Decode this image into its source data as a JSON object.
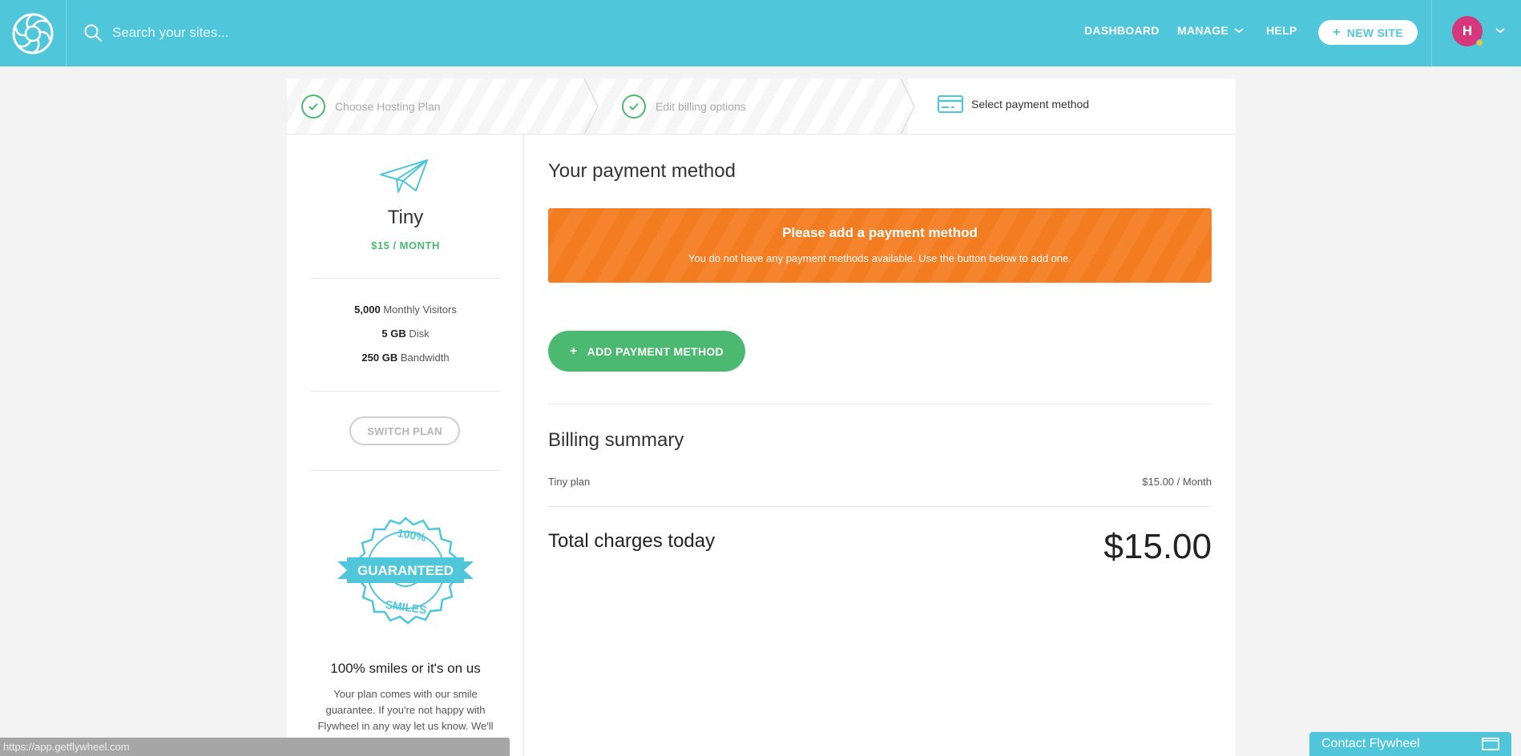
{
  "header": {
    "search_placeholder": "Search your sites...",
    "nav": {
      "dashboard": "DASHBOARD",
      "manage": "MANAGE",
      "help": "HELP"
    },
    "new_site_label": "NEW SITE",
    "avatar_initial": "H"
  },
  "steps": [
    {
      "label": "Choose Hosting Plan",
      "state": "done"
    },
    {
      "label": "Edit billing options",
      "state": "done"
    },
    {
      "label": "Select payment method",
      "state": "active"
    }
  ],
  "plan": {
    "name": "Tiny",
    "price": "$15 / MONTH",
    "features": [
      {
        "value": "5,000",
        "label": "Monthly Visitors"
      },
      {
        "value": "5 GB",
        "label": "Disk"
      },
      {
        "value": "250 GB",
        "label": "Bandwidth"
      }
    ],
    "switch_label": "SWITCH PLAN"
  },
  "guarantee": {
    "badge_top": "100%",
    "badge_middle": "GUARANTEED",
    "badge_bottom": "SMILES",
    "title": "100% smiles or it's on us",
    "body": "Your plan comes with our smile guarantee. If you're not happy with Flywheel in any way let us know. We'll refund your money and help"
  },
  "payment": {
    "heading": "Your payment method",
    "alert_title": "Please add a payment method",
    "alert_body": "You do not have any payment methods available. Use the button below to add one.",
    "add_label": "ADD PAYMENT METHOD"
  },
  "billing": {
    "heading": "Billing summary",
    "item_label": "Tiny plan",
    "item_value": "$15.00 / Month",
    "total_label": "Total charges today",
    "total_value": "$15.00"
  },
  "status_url": "https://app.getflywheel.com",
  "contact_label": "Contact Flywheel",
  "colors": {
    "brand": "#50c6db",
    "success": "#4cb971",
    "warning": "#f47c20",
    "avatar": "#d6367b"
  }
}
